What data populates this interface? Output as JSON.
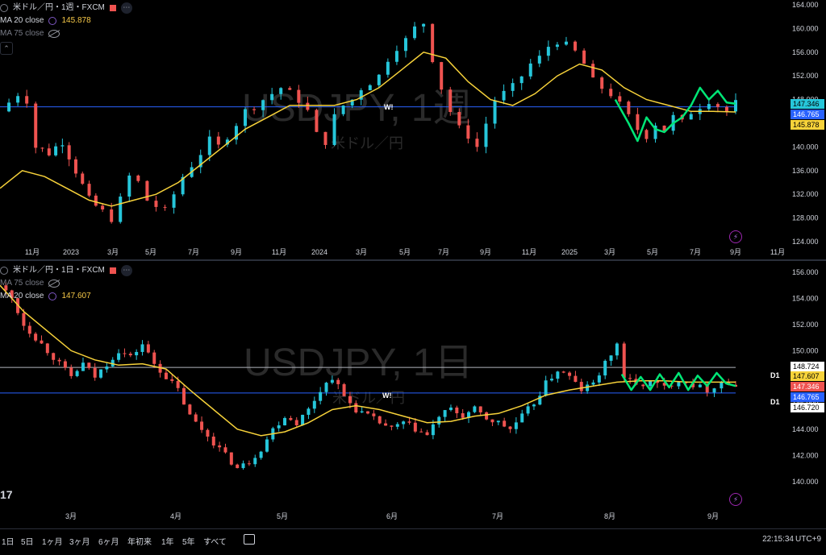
{
  "colors": {
    "up": "#26c6da",
    "down": "#ef5350",
    "ma": "#f7d23a",
    "pattern": "#00e676",
    "hline_blue": "#2962ff",
    "hline_gray": "#b2b5be",
    "axis_text": "#d1d4dc",
    "watermark": "#2a2a2a"
  },
  "top": {
    "title": "米ドル／円・1週・FXCM",
    "ma1_label": "MA 20 close",
    "ma1_value": "145.878",
    "ma2_label": "MA 75 close",
    "watermark": "USDJPY, 1週",
    "watermark_sub": "米ドル／円",
    "w_label": "W!",
    "price_ticks": [
      "164.000",
      "160.000",
      "156.000",
      "152.000",
      "148.000",
      "144.000",
      "140.000",
      "136.000",
      "132.000",
      "128.000",
      "124.000"
    ],
    "time_ticks": [
      "11月",
      "2023",
      "3月",
      "5月",
      "7月",
      "9月",
      "11月",
      "2024",
      "3月",
      "5月",
      "7月",
      "9月",
      "11月",
      "2025",
      "3月",
      "5月",
      "7月",
      "9月",
      "11月"
    ],
    "price_tags": [
      {
        "text": "147.346",
        "bg": "#26c6da",
        "fg": "#000000"
      },
      {
        "text": "146.765",
        "bg": "#2962ff",
        "fg": "#ffffff"
      },
      {
        "text": "145.878",
        "bg": "#f7d23a",
        "fg": "#000000"
      }
    ]
  },
  "bottom": {
    "title": "米ドル／円・1日・FXCM",
    "ma1_label": "MA 75 close",
    "ma2_label": "MA 20 close",
    "ma2_value": "147.607",
    "watermark": "USDJPY, 1日",
    "watermark_sub": "米ドル／円",
    "w_label": "W!",
    "logo_text": "17",
    "price_ticks": [
      "156.000",
      "154.000",
      "152.000",
      "150.000",
      "148.000",
      "146.000",
      "144.000",
      "142.000",
      "140.000"
    ],
    "time_ticks": [
      "3月",
      "4月",
      "5月",
      "6月",
      "7月",
      "8月",
      "9月"
    ],
    "d1_labels": [
      "D1",
      "D1"
    ],
    "price_tags": [
      {
        "text": "148.724",
        "bg": "#ffffff",
        "fg": "#000000"
      },
      {
        "text": "147.607",
        "bg": "#f7d23a",
        "fg": "#000000"
      },
      {
        "text": "147.346",
        "bg": "#ef5350",
        "fg": "#ffffff"
      },
      {
        "text": "146.765",
        "bg": "#2962ff",
        "fg": "#ffffff"
      },
      {
        "text": "146.720",
        "bg": "#ffffff",
        "fg": "#000000"
      }
    ]
  },
  "bottombar": {
    "ranges": [
      "1日",
      "5日",
      "1ヶ月",
      "3ヶ月",
      "6ヶ月",
      "年初来",
      "1年",
      "5年",
      "すべて"
    ],
    "clock": "22:15:34",
    "timezone": "UTC+9"
  },
  "chart_data": [
    {
      "type": "candlestick",
      "title": "米ドル／円・1週・FXCM",
      "ylim": [
        124,
        164
      ],
      "x_range": [
        "2022-09",
        "2025-11"
      ],
      "hlines": [
        {
          "value": 146.765,
          "color": "#2962ff"
        }
      ],
      "close_path": [
        [
          0,
          146
        ],
        [
          8,
          149
        ],
        [
          12,
          148
        ],
        [
          16,
          140
        ],
        [
          22,
          139
        ],
        [
          28,
          141
        ],
        [
          34,
          136
        ],
        [
          40,
          131
        ],
        [
          46,
          129
        ],
        [
          50,
          128
        ],
        [
          54,
          131
        ],
        [
          58,
          135
        ],
        [
          62,
          134
        ],
        [
          66,
          131
        ],
        [
          70,
          130
        ],
        [
          74,
          129
        ],
        [
          78,
          132
        ],
        [
          82,
          135
        ],
        [
          86,
          137
        ],
        [
          90,
          139
        ],
        [
          94,
          141
        ],
        [
          98,
          140
        ],
        [
          102,
          142
        ],
        [
          106,
          144
        ],
        [
          110,
          146
        ],
        [
          114,
          147
        ],
        [
          118,
          148
        ],
        [
          122,
          149
        ],
        [
          126,
          150
        ],
        [
          130,
          149
        ],
        [
          134,
          148
        ],
        [
          138,
          146
        ],
        [
          142,
          142
        ],
        [
          146,
          141
        ],
        [
          150,
          145
        ],
        [
          154,
          147
        ],
        [
          158,
          148
        ],
        [
          162,
          150
        ],
        [
          166,
          151
        ],
        [
          170,
          152
        ],
        [
          174,
          155
        ],
        [
          178,
          157
        ],
        [
          182,
          158
        ],
        [
          186,
          160
        ],
        [
          190,
          161
        ],
        [
          194,
          155
        ],
        [
          198,
          150
        ],
        [
          202,
          146
        ],
        [
          206,
          143
        ],
        [
          210,
          142
        ],
        [
          214,
          140
        ],
        [
          218,
          144
        ],
        [
          222,
          148
        ],
        [
          226,
          149
        ],
        [
          230,
          150
        ],
        [
          234,
          152
        ],
        [
          238,
          154
        ],
        [
          242,
          155
        ],
        [
          246,
          157
        ],
        [
          250,
          158
        ],
        [
          254,
          157
        ],
        [
          258,
          156
        ],
        [
          262,
          154
        ],
        [
          266,
          151
        ],
        [
          270,
          150
        ],
        [
          274,
          149
        ],
        [
          278,
          147
        ],
        [
          282,
          145
        ],
        [
          286,
          143
        ],
        [
          290,
          142
        ],
        [
          294,
          144
        ],
        [
          298,
          143
        ],
        [
          302,
          145
        ],
        [
          306,
          144
        ],
        [
          310,
          146
        ],
        [
          314,
          147
        ],
        [
          318,
          148
        ],
        [
          322,
          147
        ],
        [
          326,
          146
        ],
        [
          330,
          147.3
        ]
      ],
      "ma20": [
        [
          0,
          133
        ],
        [
          10,
          136
        ],
        [
          20,
          135
        ],
        [
          30,
          133
        ],
        [
          40,
          131
        ],
        [
          50,
          130
        ],
        [
          60,
          131
        ],
        [
          70,
          132
        ],
        [
          80,
          134
        ],
        [
          90,
          137
        ],
        [
          100,
          140
        ],
        [
          110,
          143
        ],
        [
          120,
          145
        ],
        [
          130,
          147
        ],
        [
          140,
          147
        ],
        [
          150,
          147
        ],
        [
          160,
          148
        ],
        [
          170,
          150
        ],
        [
          180,
          153
        ],
        [
          190,
          156
        ],
        [
          200,
          155
        ],
        [
          210,
          151
        ],
        [
          220,
          148
        ],
        [
          230,
          147
        ],
        [
          240,
          149
        ],
        [
          250,
          152
        ],
        [
          260,
          154
        ],
        [
          270,
          153
        ],
        [
          280,
          150
        ],
        [
          290,
          148
        ],
        [
          300,
          147
        ],
        [
          310,
          146
        ],
        [
          320,
          146
        ],
        [
          330,
          145.9
        ]
      ],
      "pattern": [
        [
          276,
          148
        ],
        [
          282,
          144
        ],
        [
          286,
          141
        ],
        [
          290,
          145
        ],
        [
          294,
          143
        ],
        [
          298,
          142.5
        ],
        [
          302,
          144
        ],
        [
          306,
          145
        ],
        [
          310,
          147
        ],
        [
          314,
          150
        ],
        [
          318,
          148
        ],
        [
          322,
          149.5
        ],
        [
          326,
          147.5
        ],
        [
          330,
          147.3
        ]
      ]
    },
    {
      "type": "candlestick",
      "title": "米ドル／円・1日・FXCM",
      "ylim": [
        139,
        156
      ],
      "x_range": [
        "2025-02",
        "2025-09"
      ],
      "hlines": [
        {
          "value": 148.724,
          "color": "#b2b5be"
        },
        {
          "value": 146.765,
          "color": "#2962ff"
        }
      ],
      "close_path": [
        [
          0,
          155
        ],
        [
          5,
          154
        ],
        [
          10,
          152
        ],
        [
          15,
          151
        ],
        [
          20,
          150
        ],
        [
          25,
          149
        ],
        [
          30,
          148
        ],
        [
          35,
          149
        ],
        [
          40,
          148
        ],
        [
          45,
          149
        ],
        [
          50,
          150
        ],
        [
          55,
          149.5
        ],
        [
          60,
          150.5
        ],
        [
          65,
          149
        ],
        [
          70,
          148
        ],
        [
          75,
          147
        ],
        [
          80,
          145
        ],
        [
          85,
          144
        ],
        [
          90,
          143
        ],
        [
          95,
          142
        ],
        [
          100,
          141
        ],
        [
          105,
          141.5
        ],
        [
          110,
          142.5
        ],
        [
          115,
          144
        ],
        [
          120,
          145
        ],
        [
          125,
          144.5
        ],
        [
          130,
          145.5
        ],
        [
          135,
          147
        ],
        [
          140,
          148
        ],
        [
          145,
          146.5
        ],
        [
          150,
          145.5
        ],
        [
          155,
          145
        ],
        [
          160,
          144.5
        ],
        [
          165,
          144
        ],
        [
          170,
          144.5
        ],
        [
          175,
          144
        ],
        [
          180,
          143.5
        ],
        [
          185,
          145
        ],
        [
          190,
          145.5
        ],
        [
          195,
          145
        ],
        [
          200,
          145.5
        ],
        [
          205,
          144.8
        ],
        [
          210,
          144.5
        ],
        [
          215,
          144
        ],
        [
          220,
          145
        ],
        [
          225,
          146
        ],
        [
          230,
          147.5
        ],
        [
          235,
          148.5
        ],
        [
          240,
          148
        ],
        [
          245,
          147
        ],
        [
          250,
          147.5
        ],
        [
          255,
          149
        ],
        [
          260,
          150.5
        ],
        [
          263,
          148
        ],
        [
          268,
          147.3
        ],
        [
          274,
          147.6
        ],
        [
          280,
          147.2
        ],
        [
          286,
          147.8
        ],
        [
          292,
          147.4
        ],
        [
          298,
          147.0
        ],
        [
          304,
          147.6
        ],
        [
          310,
          147.3
        ]
      ],
      "ma20": [
        [
          0,
          155
        ],
        [
          10,
          153
        ],
        [
          20,
          151.5
        ],
        [
          30,
          150
        ],
        [
          40,
          149.3
        ],
        [
          50,
          148.9
        ],
        [
          60,
          149
        ],
        [
          70,
          148.6
        ],
        [
          80,
          147
        ],
        [
          90,
          145.5
        ],
        [
          100,
          144
        ],
        [
          110,
          143.5
        ],
        [
          120,
          143.8
        ],
        [
          130,
          144.5
        ],
        [
          140,
          145.5
        ],
        [
          150,
          145.8
        ],
        [
          160,
          145.5
        ],
        [
          170,
          145
        ],
        [
          180,
          144.5
        ],
        [
          190,
          144.6
        ],
        [
          200,
          145
        ],
        [
          210,
          145.2
        ],
        [
          220,
          145.8
        ],
        [
          230,
          146.6
        ],
        [
          240,
          147
        ],
        [
          250,
          147.3
        ],
        [
          260,
          147.6
        ],
        [
          270,
          147.7
        ],
        [
          280,
          147.7
        ],
        [
          290,
          147.6
        ],
        [
          300,
          147.6
        ],
        [
          310,
          147.6
        ]
      ],
      "pattern": [
        [
          262,
          148.2
        ],
        [
          266,
          147.0
        ],
        [
          270,
          148.0
        ],
        [
          274,
          147.0
        ],
        [
          278,
          148.2
        ],
        [
          282,
          147.2
        ],
        [
          286,
          148.3
        ],
        [
          290,
          147.0
        ],
        [
          294,
          148.1
        ],
        [
          298,
          147.3
        ],
        [
          302,
          148.3
        ],
        [
          306,
          147.5
        ],
        [
          310,
          147.3
        ]
      ]
    }
  ]
}
